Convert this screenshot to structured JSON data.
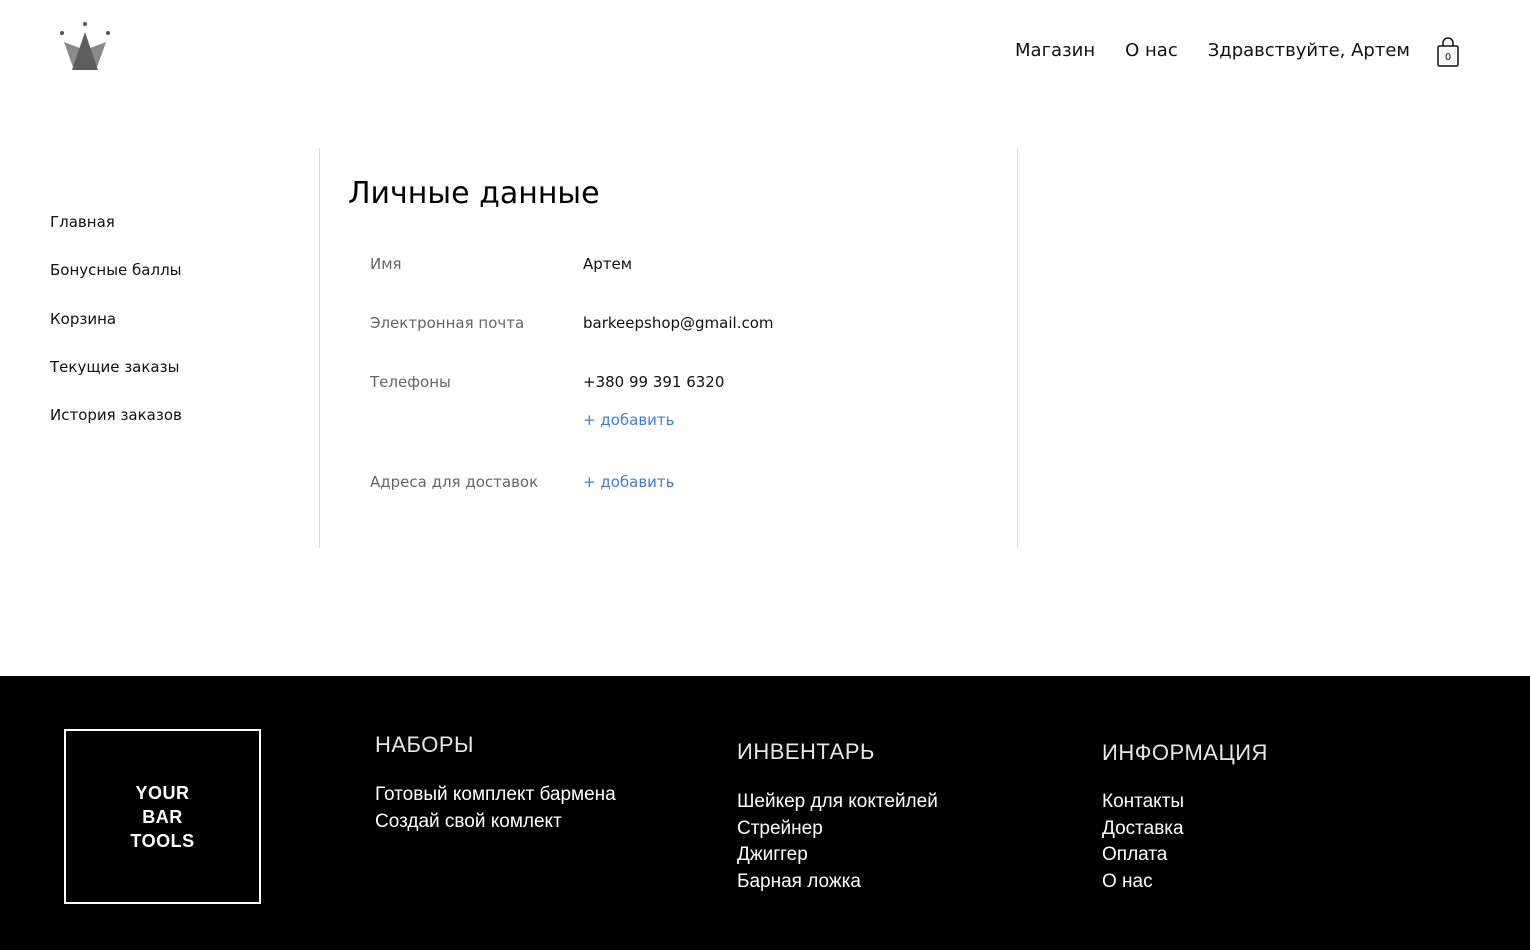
{
  "header": {
    "logo_icon": "crown-icon",
    "nav": [
      "Магазин",
      "О нас",
      "Здравствуйте, Артем"
    ],
    "cart_icon": "shopping-bag-icon",
    "cart_count": "0"
  },
  "sidebar": {
    "items": [
      "Главная",
      "Бонусные баллы",
      "Корзина",
      "Текущие заказы",
      "История заказов"
    ]
  },
  "profile": {
    "title": "Личные данные",
    "name_label": "Имя",
    "name_value": "Артем",
    "email_label": "Электронная почта",
    "email_value": "barkeepshop@gmail.com",
    "phones_label": "Телефоны",
    "phone_value": "+380 99 391 6320",
    "phone_add": "+ добавить",
    "address_label": "Адреса для доставок",
    "address_add": "+ добавить"
  },
  "footer": {
    "logo_lines": [
      "YOUR",
      "BAR",
      "TOOLS"
    ],
    "columns": [
      {
        "heading": "НАБОРЫ",
        "links": [
          "Готовый комплект бармена",
          "Создай свой комлект"
        ]
      },
      {
        "heading": "ИНВЕНТАРЬ",
        "links": [
          "Шейкер для коктейлей",
          "Стрейнер",
          "Джиггер",
          "Барная ложка"
        ]
      },
      {
        "heading": "ИНФОРМАЦИЯ",
        "links": [
          "Контакты",
          "Доставка",
          "Оплата",
          "О нас"
        ]
      }
    ]
  },
  "colors": {
    "accent_link": "#3f7fd6",
    "footer_bg": "#000000",
    "logo_gray": "#7a7a7a"
  }
}
